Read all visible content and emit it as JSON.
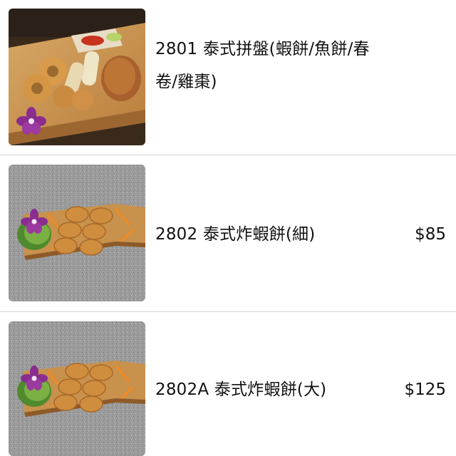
{
  "items": [
    {
      "title_line1": "2801 泰式拼盤(蝦餅/魚餅/春",
      "title_line2": "卷/雞棗)",
      "price": "",
      "image": "thai-platter-photo"
    },
    {
      "title_line1": "2802 泰式炸蝦餅(細)",
      "title_line2": "",
      "price": "$85",
      "image": "shrimp-cake-small-photo"
    },
    {
      "title_line1": "2802A 泰式炸蝦餅(大)",
      "title_line2": "",
      "price": "$125",
      "image": "shrimp-cake-large-photo"
    }
  ],
  "colors": {
    "divider": "#d6d6d6",
    "wood": "#c9924f",
    "granite": "#9a9a9a",
    "orchid": "#8a2d8f"
  }
}
